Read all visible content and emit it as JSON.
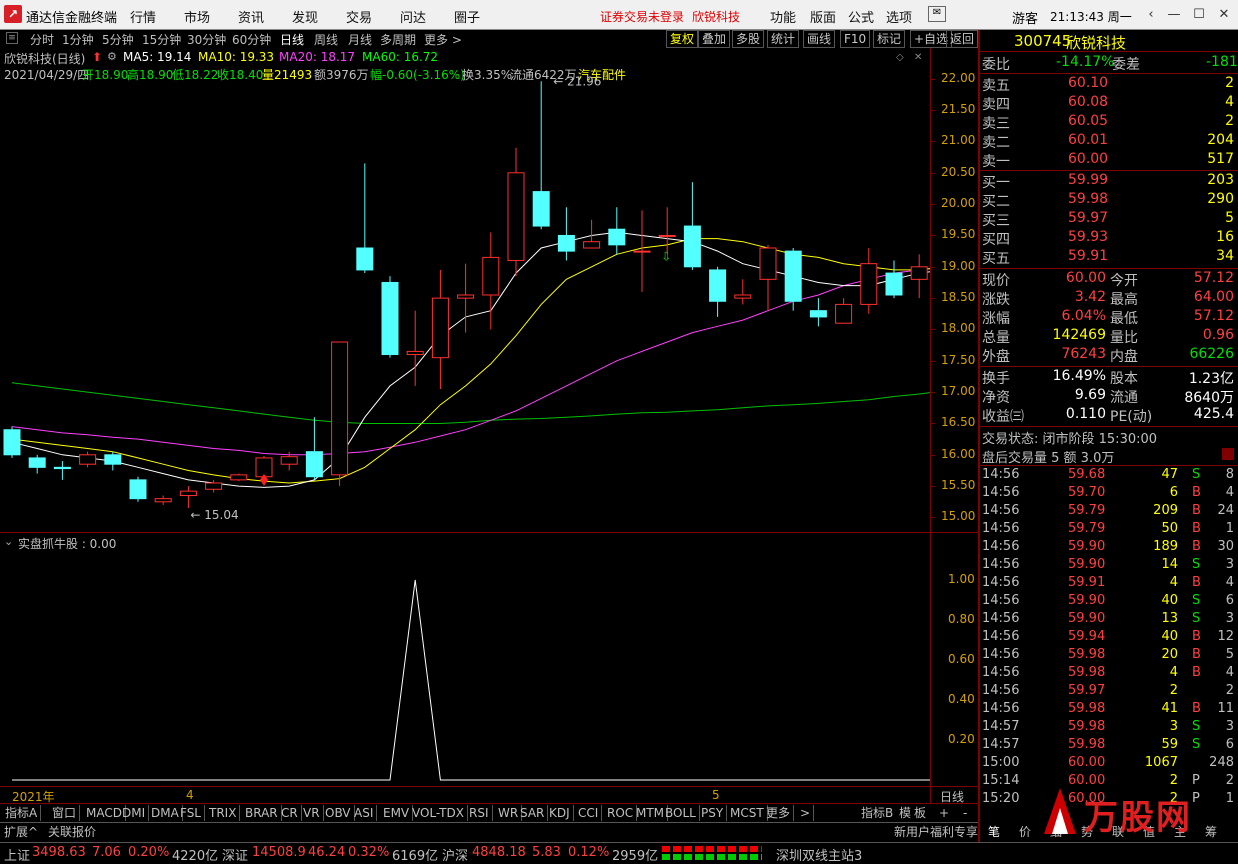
{
  "app": {
    "title": "通达信金融终端",
    "menus": [
      "行情",
      "市场",
      "资讯",
      "发现",
      "交易",
      "问达",
      "圈子"
    ],
    "notice": "证券交易未登录",
    "stock_name": "欣锐科技",
    "menus2": [
      "功能",
      "版面",
      "公式",
      "选项"
    ],
    "user": "游客",
    "clock": "21:13:43 周一"
  },
  "timeframes": [
    "分时",
    "1分钟",
    "5分钟",
    "15分钟",
    "30分钟",
    "60分钟",
    "日线",
    "周线",
    "月线",
    "多周期",
    "更多 >"
  ],
  "toolbar": [
    "复权",
    "叠加",
    "多股",
    "统计",
    "画线",
    "F10",
    "标记",
    "+自选",
    "返回"
  ],
  "chart_header": {
    "name": "欣锐科技(日线)",
    "ma5": "MA5: 19.14",
    "ma10": "MA10: 19.33",
    "ma20": "MA20: 18.17",
    "ma60": "MA60: 16.72"
  },
  "bar_info": {
    "date": "2021/04/29/四",
    "open": "开18.90",
    "high": "高18.90",
    "low": "低18.22",
    "close": "收18.40",
    "vol": "量21493",
    "amt": "额3976万",
    "chg": "幅-0.60(-3.16%)",
    "turn": "换3.35%",
    "float": "流通6422万",
    "industry": "汽车配件"
  },
  "price_axis": [
    "22.00",
    "21.50",
    "21.00",
    "20.50",
    "20.00",
    "19.50",
    "19.00",
    "18.50",
    "18.00",
    "17.50",
    "17.00",
    "16.50",
    "16.00",
    "15.50",
    "15.00"
  ],
  "max_label": "21.96",
  "min_label": "15.04",
  "indicator": {
    "name": "实盘抓牛股 : 0.00",
    "axis": [
      "1.00",
      "0.80",
      "0.60",
      "0.40",
      "0.20"
    ]
  },
  "x_labels": {
    "year": "2021年",
    "m4": "4",
    "m5": "5",
    "period": "日线"
  },
  "ind_tabs": [
    "指标A",
    "窗口",
    "MACD",
    "DMI",
    "DMA",
    "FSL",
    "TRIX",
    "BRAR",
    "CR",
    "VR",
    "OBV",
    "ASI",
    "EMV",
    "VOL-TDX",
    "RSI",
    "WR",
    "SAR",
    "KDJ",
    "CCI",
    "ROC",
    "MTM",
    "BOLL",
    "PSY",
    "MCST",
    "更多",
    ">"
  ],
  "ind_tabs_right": [
    "指标B",
    "模",
    "板",
    "+",
    "-"
  ],
  "footer_left": [
    "扩展^",
    "关联报价"
  ],
  "footer_right": "新用户福利专享",
  "footer_tabs": [
    "笔",
    "价",
    "细",
    "势",
    "联",
    "值",
    "主",
    "筹"
  ],
  "quote": {
    "code": "300745",
    "name": "欣锐科技",
    "webi": "委比",
    "webi_v": "-14.17%",
    "weicha": "委差",
    "weicha_v": "-181",
    "sell": [
      {
        "l": "卖五",
        "p": "60.10",
        "v": "2"
      },
      {
        "l": "卖四",
        "p": "60.08",
        "v": "4"
      },
      {
        "l": "卖三",
        "p": "60.05",
        "v": "2"
      },
      {
        "l": "卖二",
        "p": "60.01",
        "v": "204"
      },
      {
        "l": "卖一",
        "p": "60.00",
        "v": "517"
      }
    ],
    "buy": [
      {
        "l": "买一",
        "p": "59.99",
        "v": "203"
      },
      {
        "l": "买二",
        "p": "59.98",
        "v": "290"
      },
      {
        "l": "买三",
        "p": "59.97",
        "v": "5"
      },
      {
        "l": "买四",
        "p": "59.93",
        "v": "16"
      },
      {
        "l": "买五",
        "p": "59.91",
        "v": "34"
      }
    ],
    "stats": [
      {
        "a": "现价",
        "av": "60.00",
        "b": "今开",
        "bv": "57.12"
      },
      {
        "a": "涨跌",
        "av": "3.42",
        "b": "最高",
        "bv": "64.00"
      },
      {
        "a": "涨幅",
        "av": "6.04%",
        "b": "最低",
        "bv": "57.12"
      },
      {
        "a": "总量",
        "av": "142469",
        "b": "量比",
        "bv": "0.96"
      },
      {
        "a": "外盘",
        "av": "76243",
        "b": "内盘",
        "bv": "66226"
      }
    ],
    "stats2": [
      {
        "a": "换手",
        "av": "16.49%",
        "b": "股本",
        "bv": "1.23亿"
      },
      {
        "a": "净资",
        "av": "9.69",
        "b": "流通",
        "bv": "8640万"
      },
      {
        "a": "收益㈢",
        "av": "0.110",
        "b": "PE(动)",
        "bv": "425.4"
      }
    ],
    "state": "交易状态: 闭市阶段 15:30:00",
    "after": "盘后交易量 5 额 3.0万"
  },
  "trades": [
    {
      "t": "14:56",
      "p": "59.68",
      "v": "47",
      "s": "S",
      "n": "8"
    },
    {
      "t": "14:56",
      "p": "59.70",
      "v": "6",
      "s": "B",
      "n": "4"
    },
    {
      "t": "14:56",
      "p": "59.79",
      "v": "209",
      "s": "B",
      "n": "24"
    },
    {
      "t": "14:56",
      "p": "59.79",
      "v": "50",
      "s": "B",
      "n": "1"
    },
    {
      "t": "14:56",
      "p": "59.90",
      "v": "189",
      "s": "B",
      "n": "30"
    },
    {
      "t": "14:56",
      "p": "59.90",
      "v": "14",
      "s": "S",
      "n": "3"
    },
    {
      "t": "14:56",
      "p": "59.91",
      "v": "4",
      "s": "B",
      "n": "4"
    },
    {
      "t": "14:56",
      "p": "59.90",
      "v": "40",
      "s": "S",
      "n": "6"
    },
    {
      "t": "14:56",
      "p": "59.90",
      "v": "13",
      "s": "S",
      "n": "3"
    },
    {
      "t": "14:56",
      "p": "59.94",
      "v": "40",
      "s": "B",
      "n": "12"
    },
    {
      "t": "14:56",
      "p": "59.98",
      "v": "20",
      "s": "B",
      "n": "5"
    },
    {
      "t": "14:56",
      "p": "59.98",
      "v": "4",
      "s": "B",
      "n": "4"
    },
    {
      "t": "14:56",
      "p": "59.97",
      "v": "2",
      "s": "",
      "n": "2"
    },
    {
      "t": "14:56",
      "p": "59.98",
      "v": "41",
      "s": "B",
      "n": "11"
    },
    {
      "t": "14:57",
      "p": "59.98",
      "v": "3",
      "s": "S",
      "n": "3"
    },
    {
      "t": "14:57",
      "p": "59.98",
      "v": "59",
      "s": "S",
      "n": "6"
    },
    {
      "t": "15:00",
      "p": "60.00",
      "v": "1067",
      "s": "",
      "n": "248"
    },
    {
      "t": "15:14",
      "p": "60.00",
      "v": "2",
      "s": "P",
      "n": "2"
    },
    {
      "t": "15:20",
      "p": "60.00",
      "v": "2",
      "s": "P",
      "n": "1"
    }
  ],
  "status": {
    "sh": "上证",
    "sh_v": "3498.63",
    "sh_c": "7.06",
    "sh_p": "0.20%",
    "sh_a": "4220亿",
    "sz": "深证",
    "sz_v": "14508.9",
    "sz_c": "46.24",
    "sz_p": "0.32%",
    "sz_a": "6169亿",
    "hs": "沪深",
    "hs_v": "4848.18",
    "hs_c": "5.83",
    "hs_p": "0.12%",
    "hs_a": "2959亿",
    "station": "深圳双线主站3"
  },
  "watermark": "万股网",
  "chart_data": {
    "type": "candlestick",
    "candles": [
      [
        16.4,
        16.0,
        16.45,
        15.95
      ],
      [
        15.95,
        15.8,
        16.0,
        15.7
      ],
      [
        15.8,
        15.78,
        15.9,
        15.6
      ],
      [
        15.85,
        16.0,
        16.05,
        15.8
      ],
      [
        16.0,
        15.85,
        16.05,
        15.75
      ],
      [
        15.6,
        15.3,
        15.65,
        15.25
      ],
      [
        15.25,
        15.3,
        15.35,
        15.2
      ],
      [
        15.35,
        15.42,
        15.5,
        15.15
      ],
      [
        15.45,
        15.55,
        15.6,
        15.4
      ],
      [
        15.6,
        15.68,
        15.7,
        15.58
      ],
      [
        15.65,
        15.95,
        15.98,
        15.6
      ],
      [
        15.85,
        15.97,
        16.05,
        15.75
      ],
      [
        16.05,
        15.65,
        16.6,
        15.6
      ],
      [
        15.68,
        17.8,
        17.8,
        15.5
      ],
      [
        19.3,
        18.95,
        20.65,
        18.9
      ],
      [
        18.75,
        17.6,
        18.85,
        17.55
      ],
      [
        17.6,
        17.65,
        18.3,
        17.1
      ],
      [
        17.55,
        18.5,
        18.95,
        17.05
      ],
      [
        18.5,
        18.55,
        19.05,
        17.95
      ],
      [
        18.55,
        19.15,
        19.55,
        18.0
      ],
      [
        19.1,
        20.5,
        20.9,
        18.85
      ],
      [
        20.2,
        19.65,
        21.96,
        19.6
      ],
      [
        19.5,
        19.25,
        19.95,
        19.1
      ],
      [
        19.3,
        19.4,
        19.75,
        19.3
      ],
      [
        19.6,
        19.35,
        19.95,
        19.2
      ],
      [
        19.25,
        19.25,
        19.9,
        18.6
      ],
      [
        19.5,
        19.5,
        19.95,
        19.2
      ],
      [
        19.65,
        19.0,
        20.35,
        18.95
      ],
      [
        18.95,
        18.45,
        19.0,
        18.2
      ],
      [
        18.5,
        18.55,
        18.8,
        18.4
      ],
      [
        18.8,
        19.3,
        19.35,
        18.3
      ],
      [
        19.25,
        18.45,
        19.3,
        18.3
      ],
      [
        18.3,
        18.2,
        18.5,
        18.05
      ],
      [
        18.1,
        18.4,
        18.5,
        18.1
      ],
      [
        18.4,
        19.05,
        19.3,
        18.25
      ],
      [
        18.9,
        18.55,
        19.1,
        18.5
      ],
      [
        18.8,
        19.0,
        19.2,
        18.5
      ],
      [
        19.05,
        19.15,
        19.1,
        18.85
      ],
      [
        19.05,
        18.88,
        19.1,
        18.8
      ],
      [
        18.9,
        18.4,
        18.9,
        18.22
      ]
    ],
    "ma5": [
      16.2,
      16.1,
      16.0,
      15.95,
      15.9,
      15.8,
      15.7,
      15.6,
      15.55,
      15.5,
      15.48,
      15.5,
      15.6,
      15.95,
      16.6,
      17.1,
      17.4,
      17.9,
      18.2,
      18.3,
      18.9,
      19.3,
      19.4,
      19.5,
      19.55,
      19.5,
      19.45,
      19.4,
      19.25,
      19.05,
      18.95,
      18.85,
      18.75,
      18.7,
      18.7,
      18.8,
      18.9,
      18.95,
      19.0,
      19.14
    ],
    "ma10": [
      16.25,
      16.2,
      16.15,
      16.1,
      16.05,
      15.95,
      15.85,
      15.75,
      15.68,
      15.62,
      15.58,
      15.55,
      15.58,
      15.62,
      15.8,
      16.1,
      16.4,
      16.8,
      17.1,
      17.45,
      17.9,
      18.4,
      18.8,
      19.0,
      19.2,
      19.3,
      19.35,
      19.45,
      19.45,
      19.4,
      19.3,
      19.2,
      19.15,
      19.05,
      19.0,
      18.95,
      18.95,
      19.0,
      19.15,
      19.33
    ],
    "ma20": [
      16.45,
      16.4,
      16.35,
      16.32,
      16.28,
      16.25,
      16.2,
      16.15,
      16.1,
      16.07,
      16.02,
      16.0,
      16.0,
      16.02,
      16.05,
      16.12,
      16.2,
      16.3,
      16.4,
      16.55,
      16.7,
      16.9,
      17.1,
      17.3,
      17.5,
      17.65,
      17.8,
      17.95,
      18.05,
      18.15,
      18.3,
      18.45,
      18.55,
      18.7,
      18.8,
      18.9,
      18.95,
      19.0,
      19.1,
      18.17
    ],
    "ma60": [
      17.15,
      17.1,
      17.05,
      17.0,
      16.95,
      16.9,
      16.85,
      16.8,
      16.75,
      16.7,
      16.65,
      16.6,
      16.55,
      16.52,
      16.5,
      16.5,
      16.5,
      16.5,
      16.52,
      16.55,
      16.57,
      16.58,
      16.6,
      16.62,
      16.65,
      16.67,
      16.68,
      16.7,
      16.72,
      16.75,
      16.78,
      16.8,
      16.82,
      16.85,
      16.88,
      16.93,
      16.97,
      17.02,
      17.08,
      16.72
    ],
    "indicator_values": [
      0,
      0,
      0,
      0,
      0,
      0,
      0,
      0,
      0,
      0,
      0,
      0,
      0,
      0,
      0,
      0,
      1,
      0,
      0,
      0,
      0,
      0,
      0,
      0,
      0,
      0,
      0,
      0,
      0,
      0,
      0,
      0,
      0,
      0,
      0,
      0,
      0,
      0,
      0,
      0
    ],
    "ylim": [
      14.8,
      22.3
    ]
  }
}
